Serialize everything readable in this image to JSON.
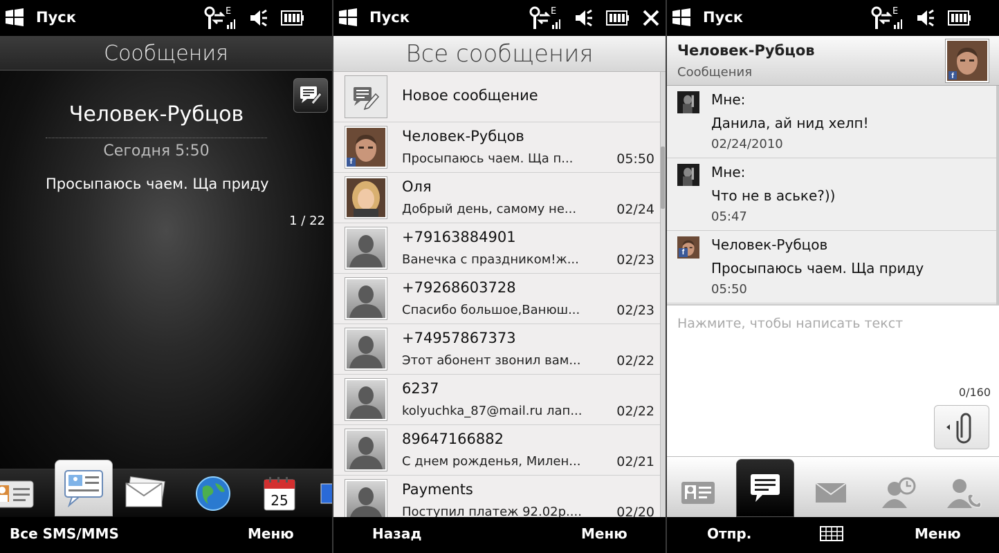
{
  "status": {
    "start_label": "Пуск",
    "network_type": "E"
  },
  "screen1": {
    "title": "Сообщения",
    "contact_name": "Человек-Рубцов",
    "time": "Сегодня 5:50",
    "message": "Просыпаюсь чаем. Ща приду",
    "counter": "1 / 22",
    "calendar_day": "25",
    "softkeys": {
      "left": "Все SMS/MMS",
      "right": "Меню"
    }
  },
  "screen2": {
    "title": "Все сообщения",
    "new_message": "Новое сообщение",
    "threads": [
      {
        "name": "Человек-Рубцов",
        "preview": "Просыпаюсь чаем. Ща п...",
        "date": "05:50",
        "avatar": "photo-man",
        "facebook": true
      },
      {
        "name": "Оля",
        "preview": "Добрый день, самому не...",
        "date": "02/24",
        "avatar": "photo-woman",
        "facebook": false
      },
      {
        "name": "+79163884901",
        "preview": "Ванечка с праздником!ж...",
        "date": "02/23",
        "avatar": "silhouette",
        "facebook": false
      },
      {
        "name": "+79268603728",
        "preview": "Спасибо большое,Ванюш...",
        "date": "02/23",
        "avatar": "silhouette",
        "facebook": false
      },
      {
        "name": "+74957867373",
        "preview": "Этот абонент звонил вам...",
        "date": "02/22",
        "avatar": "silhouette",
        "facebook": false
      },
      {
        "name": "6237",
        "preview": "kolyuchka_87@mail.ru лап...",
        "date": "02/22",
        "avatar": "silhouette",
        "facebook": false
      },
      {
        "name": "89647166882",
        "preview": "С днем рожденья, Милен...",
        "date": "02/21",
        "avatar": "silhouette",
        "facebook": false
      },
      {
        "name": "Payments",
        "preview": "Поступил платеж 92.02р....",
        "date": "02/20",
        "avatar": "silhouette",
        "facebook": false
      }
    ],
    "softkeys": {
      "left": "Назад",
      "right": "Меню"
    }
  },
  "screen3": {
    "contact_name": "Человек-Рубцов",
    "subtitle": "Сообщения",
    "messages": [
      {
        "from": "Мне:",
        "text": "Данила, ай нид хелп!",
        "time": "02/24/2010",
        "avatar": "photo-me"
      },
      {
        "from": "Мне:",
        "text": "Что не в аське?))",
        "time": "05:47",
        "avatar": "photo-me"
      },
      {
        "from": "Человек-Рубцов",
        "text": "Просыпаюсь чаем. Ща приду",
        "time": "05:50",
        "avatar": "photo-man"
      }
    ],
    "compose_placeholder": "Нажмите, чтобы написать текст",
    "char_count": "0/160",
    "softkeys": {
      "left": "Отпр.",
      "right": "Меню"
    }
  },
  "colors": {
    "facebook": "#3b5998",
    "header_light": "#e6e6e6",
    "list_bg": "#f0eeee"
  }
}
